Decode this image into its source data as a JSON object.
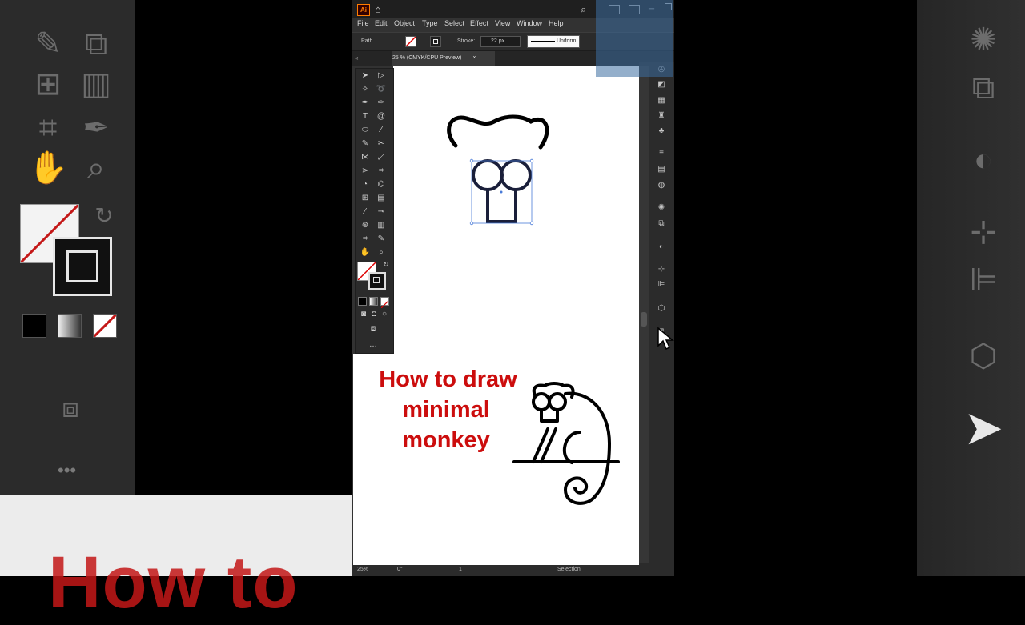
{
  "app": {
    "logo": "Ai",
    "menu": [
      "File",
      "Edit",
      "Object",
      "Type",
      "Select",
      "Effect",
      "View",
      "Window",
      "Help"
    ],
    "control": {
      "selection_type": "Path",
      "stroke_label": "Stroke:",
      "stroke_value": "22 px",
      "profile": "Uniform"
    },
    "tab": {
      "label": "25 % (CMYK/CPU Preview)",
      "close": "×"
    },
    "status": {
      "zoom": "25%",
      "rotation": "0°",
      "artboard": "1",
      "tool": "Selection"
    }
  },
  "artwork": {
    "title_lines": [
      "How to draw",
      "minimal",
      "monkey"
    ],
    "stroke_color": "#1a1f3a",
    "selection_color": "#4a7bd8"
  },
  "background": {
    "big_title": "How to",
    "title_color": "#c41818"
  },
  "colors": {
    "accent": "#ff7c00",
    "panel": "#2b2b2b",
    "title_red": "#cc0d0d"
  },
  "icons": [
    "home-icon",
    "search-icon",
    "selection-tool-icon",
    "direct-selection-tool-icon",
    "pen-tool-icon",
    "type-tool-icon",
    "ellipse-tool-icon",
    "brush-tool-icon",
    "hand-tool-icon",
    "zoom-tool-icon",
    "eyedropper-icon",
    "cursor-icon"
  ]
}
